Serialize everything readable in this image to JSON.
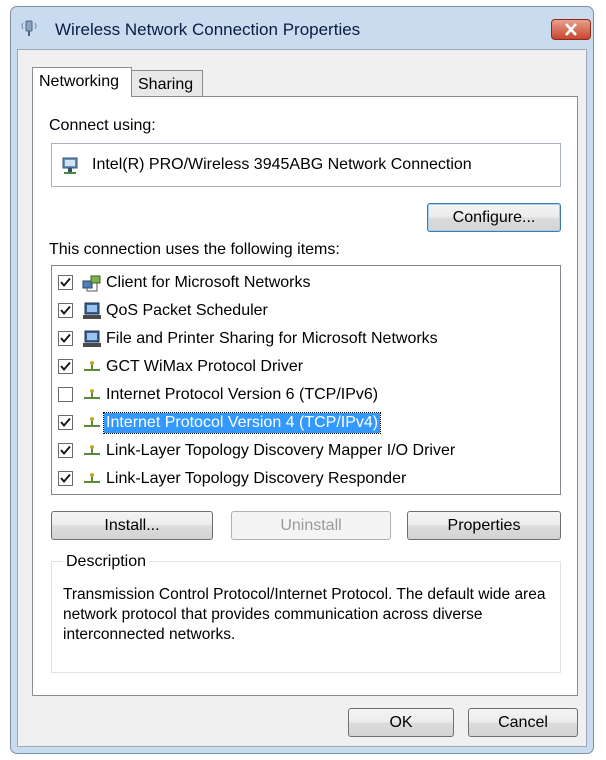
{
  "window": {
    "title": "Wireless Network Connection Properties"
  },
  "tabs": [
    {
      "label": "Networking",
      "active": true
    },
    {
      "label": "Sharing",
      "active": false
    }
  ],
  "connect_using": {
    "label": "Connect using:",
    "adapter": "Intel(R) PRO/Wireless 3945ABG Network Connection",
    "configure_button": "Configure..."
  },
  "items_label": "This connection uses the following items:",
  "items": [
    {
      "label": "Client for Microsoft Networks",
      "checked": true,
      "icon": "network-client-icon",
      "selected": false
    },
    {
      "label": "QoS Packet Scheduler",
      "checked": true,
      "icon": "computer-icon",
      "selected": false
    },
    {
      "label": "File and Printer Sharing for Microsoft Networks",
      "checked": true,
      "icon": "computer-icon",
      "selected": false
    },
    {
      "label": "GCT WiMax Protocol Driver",
      "checked": true,
      "icon": "protocol-icon",
      "selected": false
    },
    {
      "label": "Internet Protocol Version 6 (TCP/IPv6)",
      "checked": false,
      "icon": "protocol-icon",
      "selected": false
    },
    {
      "label": "Internet Protocol Version 4 (TCP/IPv4)",
      "checked": true,
      "icon": "protocol-icon",
      "selected": true
    },
    {
      "label": "Link-Layer Topology Discovery Mapper I/O Driver",
      "checked": true,
      "icon": "protocol-icon",
      "selected": false
    },
    {
      "label": "Link-Layer Topology Discovery Responder",
      "checked": true,
      "icon": "protocol-icon",
      "selected": false
    }
  ],
  "buttons": {
    "install": "Install...",
    "uninstall": "Uninstall",
    "properties": "Properties",
    "ok": "OK",
    "cancel": "Cancel"
  },
  "description": {
    "label": "Description",
    "text": "Transmission Control Protocol/Internet Protocol. The default wide area network protocol that provides communication across diverse interconnected networks."
  },
  "colors": {
    "selection": "#3399ff",
    "frame": "#c9dcef",
    "close_button": "#c8452e"
  }
}
